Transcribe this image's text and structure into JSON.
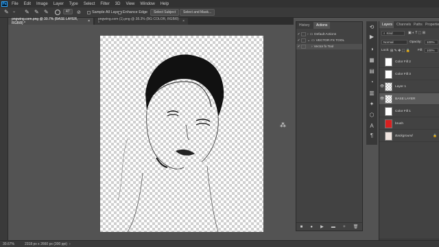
{
  "app": {
    "logo": "Ps"
  },
  "menu": [
    "File",
    "Edit",
    "Image",
    "Layer",
    "Type",
    "Select",
    "Filter",
    "3D",
    "View",
    "Window",
    "Help"
  ],
  "options": {
    "brush_size": "47",
    "sample_all_layers": "Sample All Layers",
    "enhance_edge": "Enhance Edge",
    "select_subject": "Select Subject",
    "select_and_mask": "Select and Mask..."
  },
  "tabs": [
    {
      "label": "pngwing.com.png @ 30.7% (BASE LAYER, RGB/8) *",
      "close": "×"
    },
    {
      "label": "pngwing.com (1).png @ 38.3% (BG COLOR, RGB/8) *",
      "close": "×"
    }
  ],
  "actions_panel": {
    "tabs": [
      "History",
      "Actions"
    ],
    "rows": [
      {
        "check": "✓",
        "label": "Default Actions"
      },
      {
        "check": "✓",
        "label": "VECTOR FX TOOL"
      },
      {
        "check": "✓",
        "label": "Vector fx Tool"
      }
    ],
    "footer": [
      "■",
      "●",
      "▶",
      "▬",
      "+",
      "🗑"
    ]
  },
  "layers_panel": {
    "tabs": [
      "Layers",
      "Channels",
      "Paths",
      "Properties"
    ],
    "kind": "Kind",
    "blend_mode": "Normal",
    "opacity_label": "Opacity:",
    "opacity_value": "100%",
    "lock_label": "Lock:",
    "fill_label": "Fill:",
    "fill_value": "100%",
    "layers": [
      {
        "name": "Color Fill 2",
        "visible": ""
      },
      {
        "name": "Color Fill 3",
        "visible": ""
      },
      {
        "name": "Layer 1",
        "visible": "👁"
      },
      {
        "name": "BASE LAYER",
        "visible": "👁"
      },
      {
        "name": "Color Fill 1",
        "visible": ""
      },
      {
        "name": "brush",
        "visible": ""
      },
      {
        "name": "Background",
        "visible": ""
      }
    ],
    "footer": [
      "⛓",
      "fx",
      "◐",
      "◑",
      "▣",
      "+",
      "🗑"
    ]
  },
  "status": {
    "zoom": "30.67%",
    "doc_info": "2318 px x 2660 px (300 ppi)"
  }
}
